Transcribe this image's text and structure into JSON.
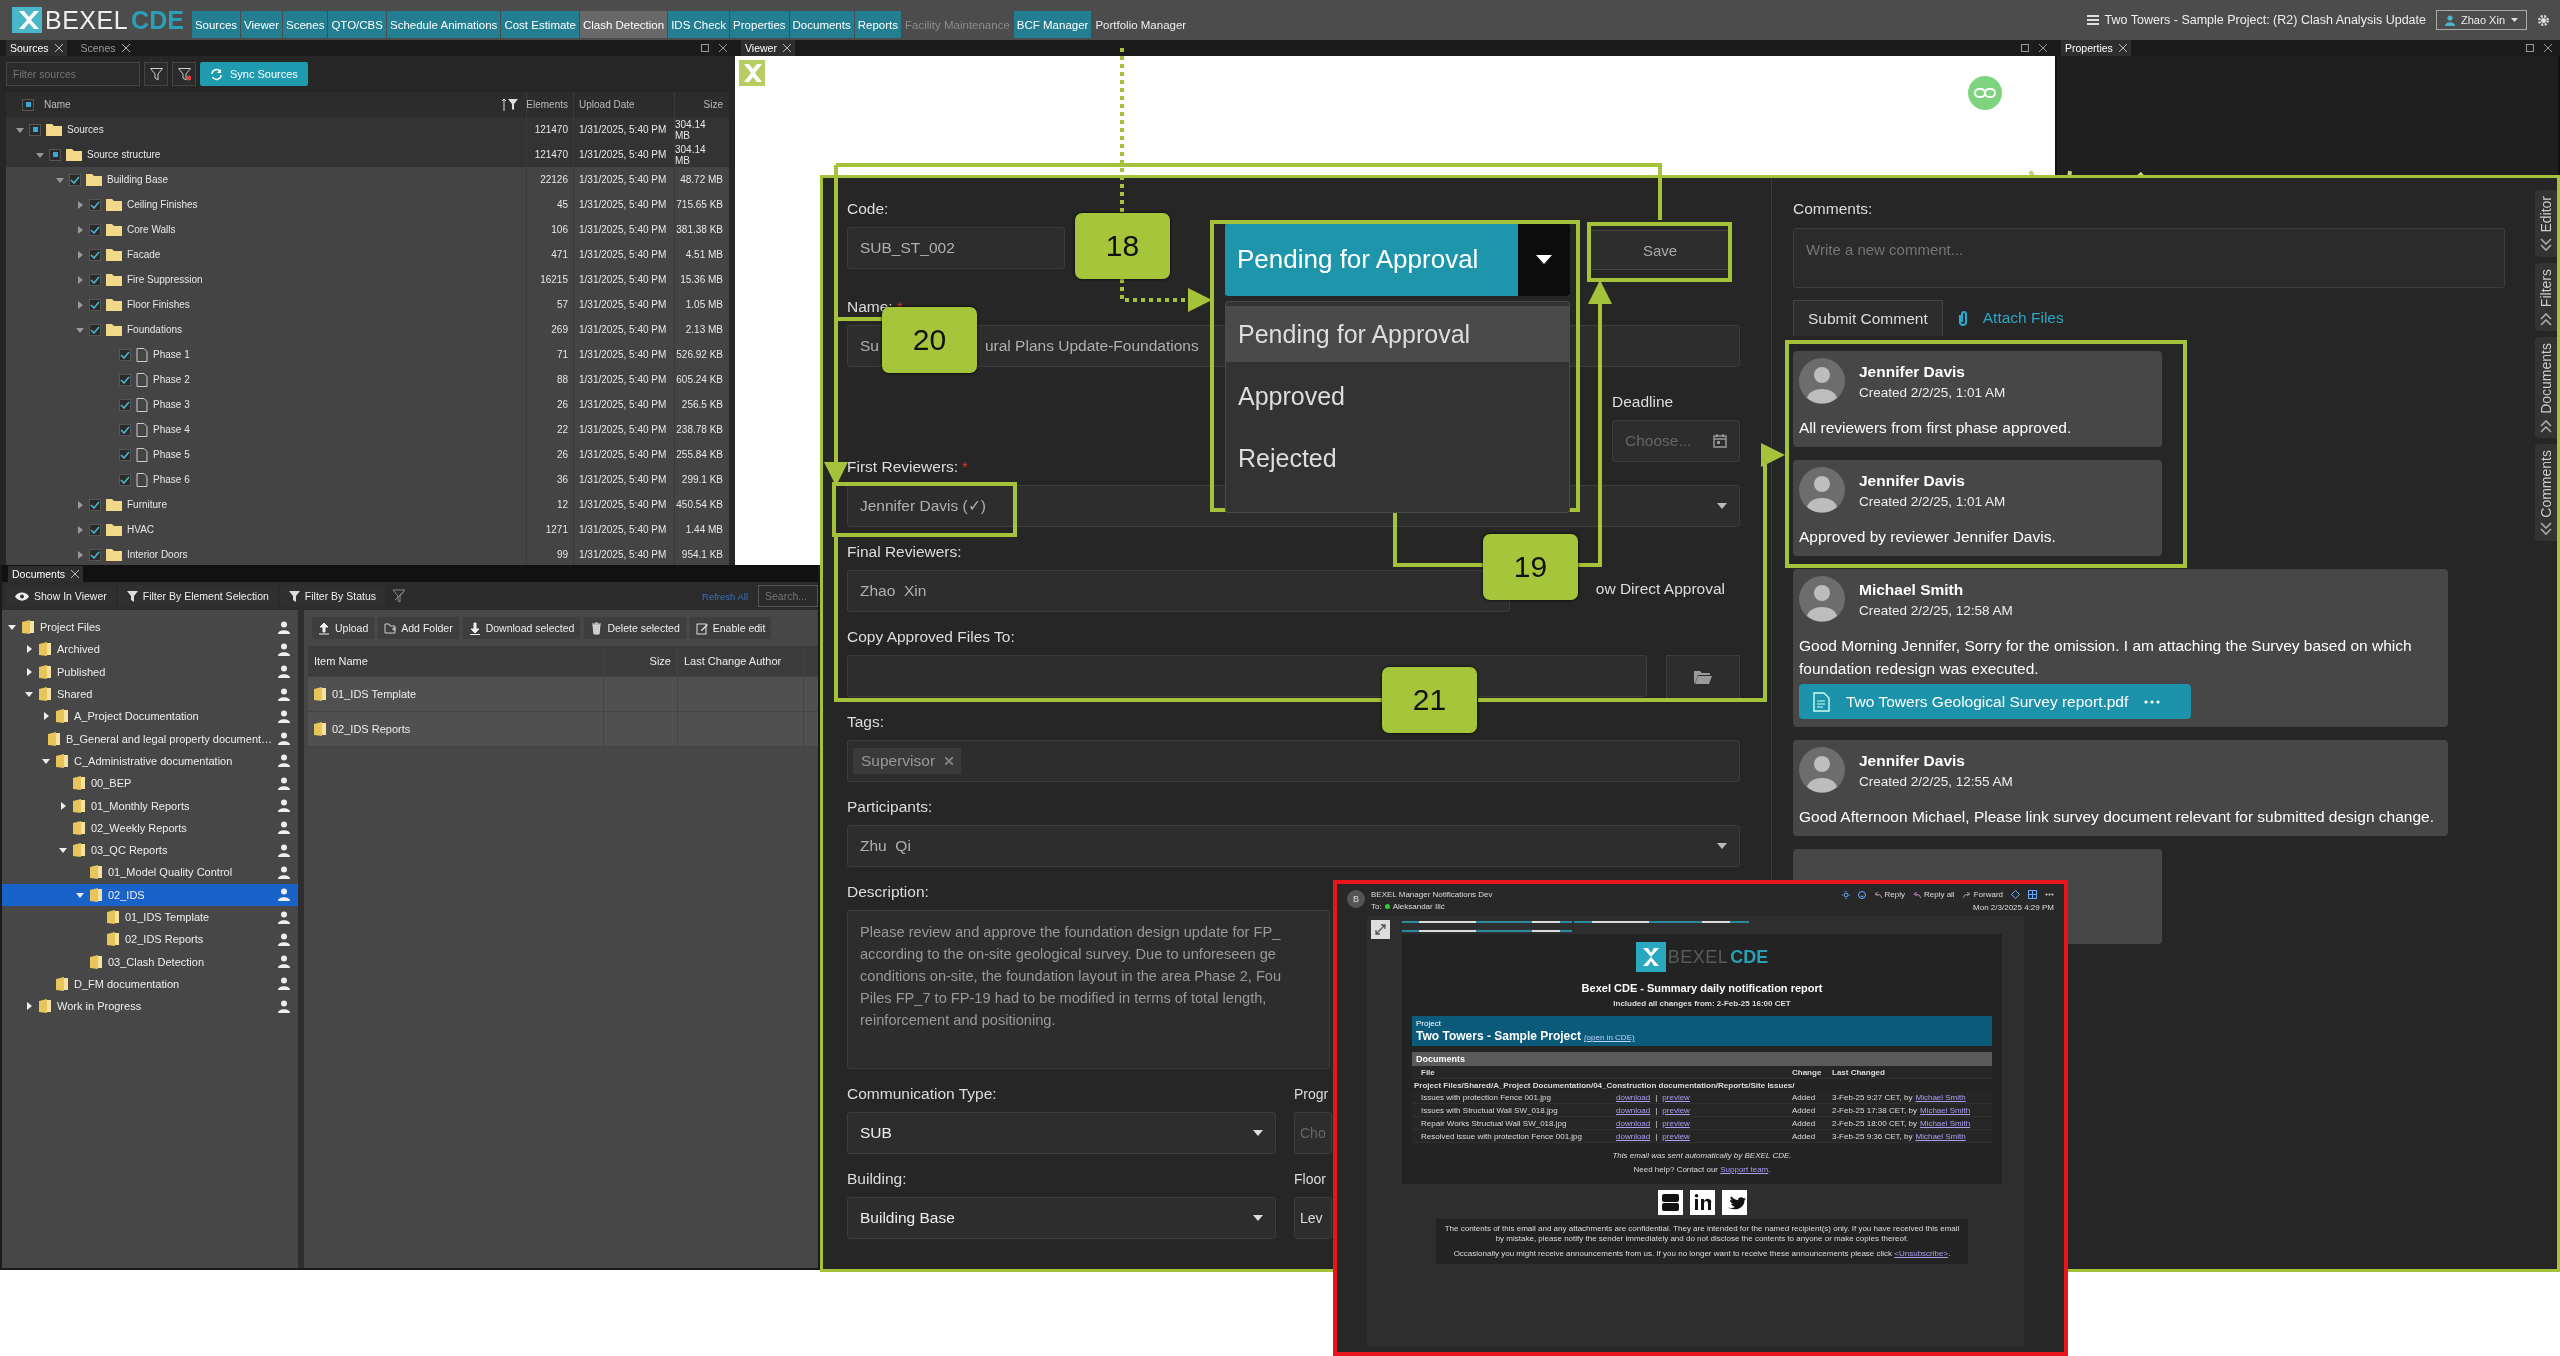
{
  "app": {
    "logo": {
      "text": "BEXEL",
      "suffix": "CDE"
    },
    "menu": [
      {
        "label": "Sources",
        "kind": "module"
      },
      {
        "label": "Viewer",
        "kind": "module"
      },
      {
        "label": "Scenes",
        "kind": "module"
      },
      {
        "label": "QTO/CBS",
        "kind": "module"
      },
      {
        "label": "Schedule Animations",
        "kind": "module"
      },
      {
        "label": "Cost Estimate",
        "kind": "module"
      },
      {
        "label": "Clash Detection",
        "kind": "inactive"
      },
      {
        "label": "IDS Check",
        "kind": "module"
      },
      {
        "label": "Properties",
        "kind": "module"
      },
      {
        "label": "Documents",
        "kind": "module"
      },
      {
        "label": "Reports",
        "kind": "module"
      },
      {
        "label": "Facility Maintenance",
        "kind": "disabled"
      },
      {
        "label": "BCF Manager",
        "kind": "module"
      },
      {
        "label": "Portfolio Manager",
        "kind": "plain"
      }
    ],
    "project_title": "Two Towers - Sample Project: (R2) Clash Analysis Update",
    "user": "Zhao Xin"
  },
  "sources_panel": {
    "tabs": [
      {
        "label": "Sources",
        "selected": true
      },
      {
        "label": "Scenes",
        "selected": false
      }
    ],
    "filter_placeholder": "Filter sources",
    "sync_button": "Sync Sources",
    "header_partial": true,
    "columns": [
      "Name",
      "Elements",
      "Upload Date",
      "Size"
    ],
    "tree": [
      {
        "name": "Sources",
        "elements": "121470",
        "date": "1/31/2025, 5:40 PM",
        "size": "304.14 MB",
        "checked": false,
        "partial": true,
        "expanded": true,
        "kind": "folder",
        "children": [
          {
            "name": "Source structure",
            "elements": "121470",
            "date": "1/31/2025, 5:40 PM",
            "size": "304.14 MB",
            "checked": false,
            "partial": true,
            "expanded": true,
            "kind": "folder",
            "children": [
              {
                "name": "Building Base",
                "elements": "22126",
                "date": "1/31/2025, 5:40 PM",
                "size": "48.72 MB",
                "checked": true,
                "partial": false,
                "expanded": true,
                "kind": "folder",
                "children": [
                  {
                    "name": "Ceiling Finishes",
                    "elements": "45",
                    "date": "1/31/2025, 5:40 PM",
                    "size": "715.65 KB",
                    "checked": true,
                    "partial": false,
                    "expanded": false,
                    "kind": "folder"
                  },
                  {
                    "name": "Core Walls",
                    "elements": "106",
                    "date": "1/31/2025, 5:40 PM",
                    "size": "381.38 KB",
                    "checked": true,
                    "partial": false,
                    "expanded": false,
                    "kind": "folder"
                  },
                  {
                    "name": "Facade",
                    "elements": "471",
                    "date": "1/31/2025, 5:40 PM",
                    "size": "4.51 MB",
                    "checked": true,
                    "partial": false,
                    "expanded": false,
                    "kind": "folder"
                  },
                  {
                    "name": "Fire Suppression",
                    "elements": "16215",
                    "date": "1/31/2025, 5:40 PM",
                    "size": "15.36 MB",
                    "checked": true,
                    "partial": false,
                    "expanded": false,
                    "kind": "folder"
                  },
                  {
                    "name": "Floor Finishes",
                    "elements": "57",
                    "date": "1/31/2025, 5:40 PM",
                    "size": "1.05 MB",
                    "checked": true,
                    "partial": false,
                    "expanded": false,
                    "kind": "folder"
                  },
                  {
                    "name": "Foundations",
                    "elements": "269",
                    "date": "1/31/2025, 5:40 PM",
                    "size": "2.13 MB",
                    "checked": true,
                    "partial": false,
                    "expanded": true,
                    "kind": "folder",
                    "children": [
                      {
                        "name": "Phase 1",
                        "elements": "71",
                        "date": "1/31/2025, 5:40 PM",
                        "size": "526.92 KB",
                        "checked": true,
                        "partial": false,
                        "kind": "file"
                      },
                      {
                        "name": "Phase 2",
                        "elements": "88",
                        "date": "1/31/2025, 5:40 PM",
                        "size": "605.24 KB",
                        "checked": true,
                        "partial": false,
                        "kind": "file"
                      },
                      {
                        "name": "Phase 3",
                        "elements": "26",
                        "date": "1/31/2025, 5:40 PM",
                        "size": "256.5 KB",
                        "checked": true,
                        "partial": false,
                        "kind": "file"
                      },
                      {
                        "name": "Phase 4",
                        "elements": "22",
                        "date": "1/31/2025, 5:40 PM",
                        "size": "238.78 KB",
                        "checked": true,
                        "partial": false,
                        "kind": "file"
                      },
                      {
                        "name": "Phase 5",
                        "elements": "26",
                        "date": "1/31/2025, 5:40 PM",
                        "size": "255.84 KB",
                        "checked": true,
                        "partial": false,
                        "kind": "file"
                      },
                      {
                        "name": "Phase 6",
                        "elements": "36",
                        "date": "1/31/2025, 5:40 PM",
                        "size": "299.1 KB",
                        "checked": true,
                        "partial": false,
                        "kind": "file"
                      }
                    ]
                  },
                  {
                    "name": "Furniture",
                    "elements": "12",
                    "date": "1/31/2025, 5:40 PM",
                    "size": "450.54 KB",
                    "checked": true,
                    "partial": false,
                    "expanded": false,
                    "kind": "folder"
                  },
                  {
                    "name": "HVAC",
                    "elements": "1271",
                    "date": "1/31/2025, 5:40 PM",
                    "size": "1.44 MB",
                    "checked": true,
                    "partial": false,
                    "expanded": false,
                    "kind": "folder"
                  },
                  {
                    "name": "Interior Doors",
                    "elements": "99",
                    "date": "1/31/2025, 5:40 PM",
                    "size": "954.1 KB",
                    "checked": true,
                    "partial": false,
                    "expanded": false,
                    "kind": "folder"
                  }
                ]
              }
            ]
          }
        ]
      }
    ]
  },
  "viewer": {
    "tab": "Viewer"
  },
  "properties": {
    "tab": "Properties"
  },
  "documents_panel": {
    "tab": "Documents",
    "toolbar": [
      {
        "label": "Show In Viewer",
        "kind": "view"
      },
      {
        "label": "Filter By Element Selection",
        "kind": "filter"
      },
      {
        "label": "Filter By Status",
        "kind": "filter"
      }
    ],
    "refresh": "Refresh All",
    "search_placeholder": "Search...",
    "tree": [
      {
        "name": "Project Files",
        "expanded": true,
        "selected": false,
        "children": [
          {
            "name": "Archived",
            "expanded": false,
            "selected": false
          },
          {
            "name": "Published",
            "expanded": false,
            "selected": false
          },
          {
            "name": "Shared",
            "expanded": true,
            "selected": false,
            "children": [
              {
                "name": "A_Project Documentation",
                "expanded": false,
                "selected": false
              },
              {
                "name": "B_General and legal property document…",
                "selected": false
              },
              {
                "name": "C_Administrative documentation",
                "expanded": true,
                "selected": false,
                "children": [
                  {
                    "name": "00_BEP",
                    "selected": false
                  },
                  {
                    "name": "01_Monthly Reports",
                    "expanded": false,
                    "selected": false
                  },
                  {
                    "name": "02_Weekly Reports",
                    "selected": false
                  },
                  {
                    "name": "03_QC Reports",
                    "expanded": true,
                    "selected": false,
                    "children": [
                      {
                        "name": "01_Model Quality Control",
                        "selected": false
                      },
                      {
                        "name": "02_IDS",
                        "expanded": true,
                        "selected": true,
                        "children": [
                          {
                            "name": "01_IDS Template",
                            "selected": false
                          },
                          {
                            "name": "02_IDS Reports",
                            "selected": false
                          }
                        ]
                      },
                      {
                        "name": "03_Clash Detection",
                        "selected": false
                      }
                    ]
                  }
                ]
              },
              {
                "name": "D_FM documentation",
                "selected": false
              }
            ]
          },
          {
            "name": "Work in Progress",
            "expanded": false,
            "selected": false
          }
        ]
      }
    ],
    "actions": [
      {
        "label": "Upload",
        "kind": "upload"
      },
      {
        "label": "Add Folder",
        "kind": "add-folder"
      },
      {
        "label": "Download selected",
        "kind": "download"
      },
      {
        "label": "Delete selected",
        "kind": "delete"
      },
      {
        "label": "Enable edit",
        "kind": "edit"
      }
    ],
    "columns": [
      "Item Name",
      "Size",
      "Last Change Author"
    ],
    "rows": [
      {
        "name": "01_IDS Template"
      },
      {
        "name": "02_IDS Reports"
      }
    ]
  },
  "form": {
    "code": {
      "label": "Code:",
      "value": "SUB_ST_002"
    },
    "name": {
      "label": "Name:",
      "required_mark": "*",
      "value_parts": [
        "Su",
        "ural Plans Update-Foundations"
      ]
    },
    "status": {
      "value": "Pending for Approval",
      "options": [
        {
          "label": "Pending for Approval",
          "selected": true
        },
        {
          "label": "Approved",
          "selected": false
        },
        {
          "label": "Rejected",
          "selected": false
        }
      ]
    },
    "save": "Save",
    "deadline": {
      "label": "Deadline",
      "placeholder": "Choose..."
    },
    "first_reviewers": {
      "label": "First Reviewers:",
      "required_mark": "*",
      "value": "Jennifer Davis (✓)"
    },
    "final_reviewers": {
      "label": "Final Reviewers:",
      "value": "Zhao  Xin"
    },
    "direct_approval": {
      "label": "ow Direct Approval"
    },
    "copy_to": {
      "label": "Copy Approved Files To:"
    },
    "tags": {
      "label": "Tags:",
      "items": [
        "Supervisor"
      ]
    },
    "participants": {
      "label": "Participants:",
      "value": "Zhu  Qi"
    },
    "description": {
      "label": "Description:",
      "lines": [
        "Please review and approve the foundation design update for FP_",
        "according to the on-site geological survey. Due to unforeseen ge",
        "conditions on-site, the foundation layout in the area Phase 2, Fou",
        "Piles FP_7 to FP-19 had to be modified in terms of total length,",
        "reinforcement and positioning."
      ]
    },
    "communication_type": {
      "label": "Communication Type:",
      "value": "SUB"
    },
    "field_progr": {
      "label": "Progr",
      "placeholder": "Cho"
    },
    "building": {
      "label": "Building:",
      "value": "Building Base"
    },
    "floor": {
      "label": "Floor",
      "value": "Lev"
    }
  },
  "comments": {
    "label": "Comments:",
    "placeholder": "Write a new comment...",
    "submit": "Submit Comment",
    "attach": "Attach Files",
    "items": [
      {
        "kind": "comment",
        "author": "Jennifer Davis",
        "created": "Created 2/2/25, 1:01 AM",
        "text": "All reviewers from first phase approved."
      },
      {
        "kind": "comment",
        "author": "Jennifer Davis",
        "created": "Created 2/2/25, 1:01 AM",
        "text": "Approved by reviewer Jennifer Davis."
      },
      {
        "kind": "comment",
        "author": "Michael Smith",
        "created": "Created 2/2/25, 12:58 AM",
        "text": "Good Morning Jennifer, Sorry for the omission. I am attaching the Survey based on which foundation redesign was executed.",
        "attachment": "Two Towers Geological Survey report.pdf"
      },
      {
        "kind": "comment",
        "author": "Jennifer Davis",
        "created": "Created 2/2/25, 12:55 AM",
        "text": "Good Afternoon Michael, Please link survey document relevant for submitted design change."
      },
      {
        "kind": "covered"
      }
    ],
    "side_tabs": [
      {
        "label": "Editor",
        "kind": "expand"
      },
      {
        "label": "Filters",
        "kind": "collapse"
      },
      {
        "label": "Documents",
        "kind": "collapse"
      },
      {
        "label": "Comments",
        "kind": "expand"
      }
    ]
  },
  "callouts": [
    {
      "number": "18"
    },
    {
      "number": "19"
    },
    {
      "number": "20"
    },
    {
      "number": "21"
    }
  ],
  "email": {
    "sender_initial": "B",
    "sender": "BEXEL Manager Notifications Dev",
    "to_label": "To:",
    "recipient": "Aleksandar Ilić",
    "actions": [
      {
        "label": "Reply",
        "kind": "reply"
      },
      {
        "label": "Reply all",
        "kind": "reply-all"
      },
      {
        "label": "Forward",
        "kind": "forward"
      }
    ],
    "date": "Mon 2/3/2025 4:29 PM",
    "logo": {
      "text": "BEXEL",
      "suffix": "CDE"
    },
    "title": "Bexel CDE - Summary daily notification report",
    "subtitle": "Included all changes from: 2-Feb-25 16:00 CET",
    "project_label": "Project",
    "project": "Two Towers - Sample Project",
    "project_link": "(open in CDE)",
    "section": "Documents",
    "columns": [
      "File",
      "Change",
      "Last Changed"
    ],
    "path": "Project Files/Shared/A_Project Documentation/04_Construction documentation/Reports/Site Issues/",
    "separator": "|",
    "rows": [
      {
        "file": "Issues with protection Fence 001.jpg",
        "links": [
          "download",
          "preview"
        ],
        "change": "Added",
        "changed": "3-Feb-25 9:27 CET, by",
        "author": "Michael Smith"
      },
      {
        "file": "Issues with Structual Wall SW_018.jpg",
        "links": [
          "download",
          "preview"
        ],
        "change": "Added",
        "changed": "2-Feb-25 17:38 CET, by",
        "author": "Michael Smith"
      },
      {
        "file": "Repair Works Structual Wall SW_018.jpg",
        "links": [
          "download",
          "preview"
        ],
        "change": "Added",
        "changed": "2-Feb-25 18:00 CET, by",
        "author": "Michael Smith"
      },
      {
        "file": "Resolved issue with protection Fence 001.jpg",
        "links": [
          "download",
          "preview"
        ],
        "change": "Added",
        "changed": "3-Feb-25 9:36 CET, by",
        "author": "Michael Smith"
      }
    ],
    "auto_note": "This email was sent automatically by BEXEL CDE.",
    "help_text": "Need help? Contact our ",
    "help_link": "Support team",
    "help_end": ".",
    "legal": "The contents of this email and any attachments are confidential. They are intended for the named recipient(s) only. If you have received this email by mistake, please notify the sender immediately and do not disclose the contents to anyone or make copies thereof.",
    "unsubscribe_text": "Occasionally you might receive announcements from us. If you no longer want to receive these announcements please click ",
    "unsubscribe_link": "<Unsubscribe>",
    "unsubscribe_end": "."
  }
}
